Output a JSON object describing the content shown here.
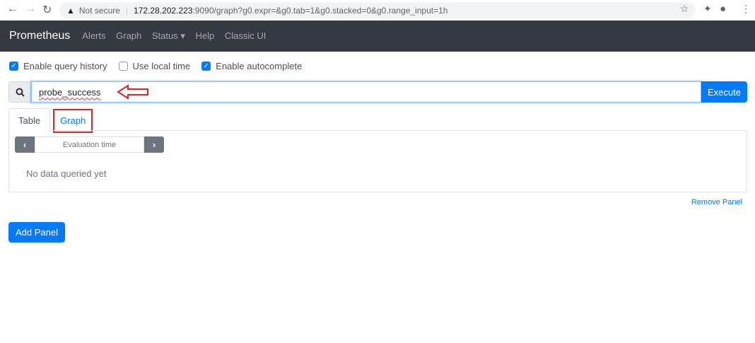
{
  "browser": {
    "security": "Not secure",
    "url_host": "172.28.202.223",
    "url_rest": ":9090/graph?g0.expr=&g0.tab=1&g0.stacked=0&g0.range_input=1h"
  },
  "navbar": {
    "brand": "Prometheus",
    "items": [
      "Alerts",
      "Graph",
      "Status",
      "Help",
      "Classic UI"
    ]
  },
  "options": [
    {
      "label": "Enable query history",
      "checked": true
    },
    {
      "label": "Use local time",
      "checked": false
    },
    {
      "label": "Enable autocomplete",
      "checked": true
    }
  ],
  "query": {
    "value": "probe_success",
    "execute": "Execute"
  },
  "tabs": {
    "table": "Table",
    "graph": "Graph"
  },
  "panel": {
    "eval_time": "Evaluation time",
    "no_data": "No data queried yet",
    "remove": "Remove Panel"
  },
  "add_panel": "Add Panel"
}
